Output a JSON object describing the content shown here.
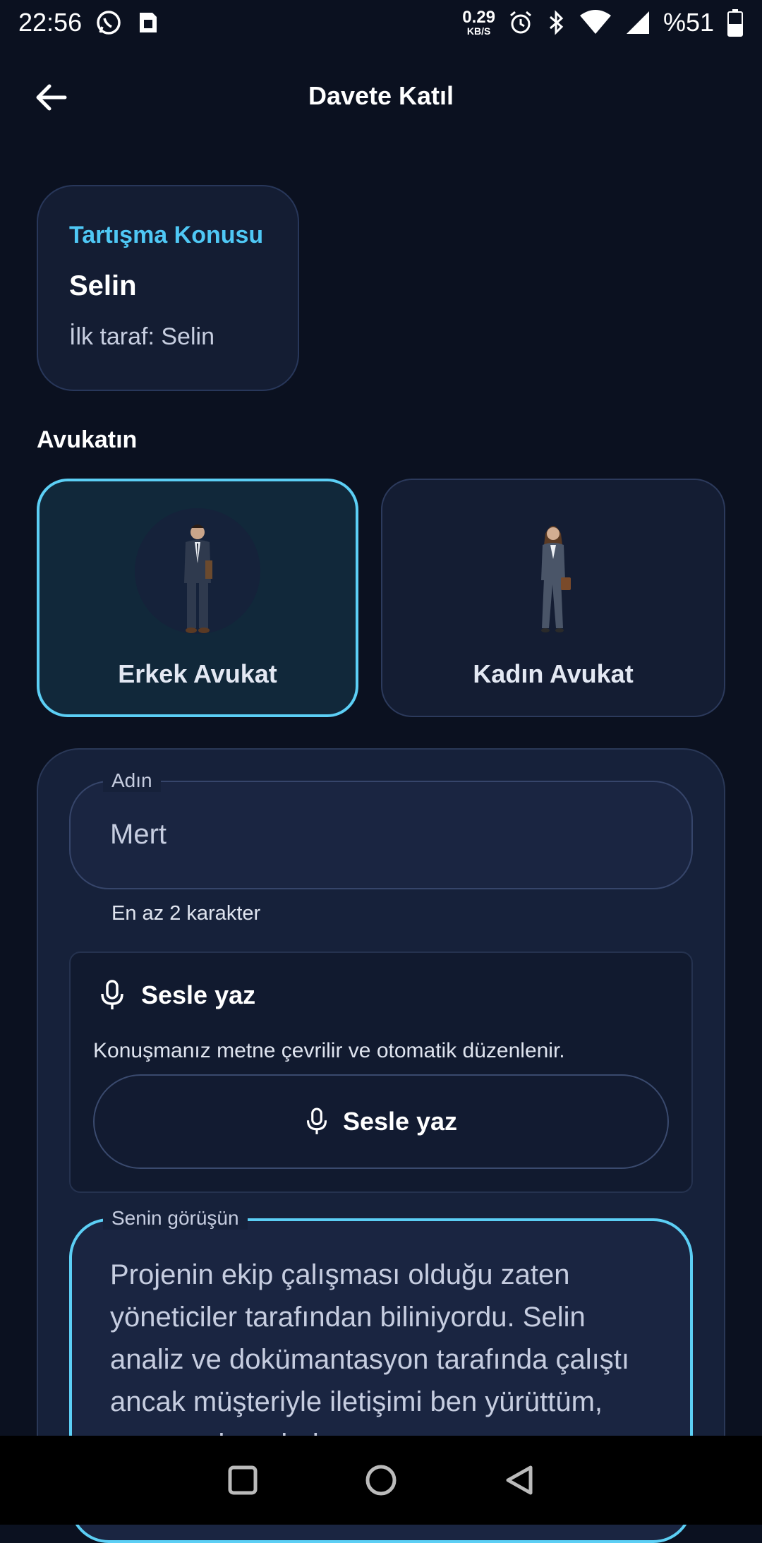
{
  "status_bar": {
    "time": "22:56",
    "net_speed_value": "0.29",
    "net_speed_unit": "KB/S",
    "battery_text": "%51"
  },
  "header": {
    "title": "Davete Katıl"
  },
  "topic_card": {
    "label": "Tartışma Konusu",
    "name": "Selin",
    "first_party": "İlk taraf: Selin"
  },
  "lawyer_section": {
    "title": "Avukatın",
    "options": [
      {
        "label": "Erkek Avukat",
        "selected": true
      },
      {
        "label": "Kadın Avukat",
        "selected": false
      }
    ]
  },
  "form": {
    "name_field": {
      "legend": "Adın",
      "value": "Mert",
      "helper": "En az 2 karakter"
    },
    "voice": {
      "title": "Sesle yaz",
      "description": "Konuşmanız metne çevrilir ve otomatik düzenlenir.",
      "button_label": "Sesle yaz"
    },
    "opinion_field": {
      "legend": "Senin görüşün",
      "value": "Projenin ekip çalışması olduğu zaten yöneticiler tarafından biliniyordu. Selin analiz ve dokümantasyon tarafında çalıştı ancak müşteriyle iletişimi ben yürüttüm, sunumu hazırladım ve"
    }
  },
  "colors": {
    "accent": "#5ccff5",
    "background": "#0b1120",
    "card": "#16213a"
  },
  "icons": [
    "whatsapp-icon",
    "sim-icon",
    "alarm-icon",
    "bluetooth-icon",
    "wifi-icon",
    "signal-icon",
    "battery-icon",
    "back-arrow-icon",
    "mic-icon",
    "nav-recents-icon",
    "nav-home-icon",
    "nav-back-icon"
  ]
}
